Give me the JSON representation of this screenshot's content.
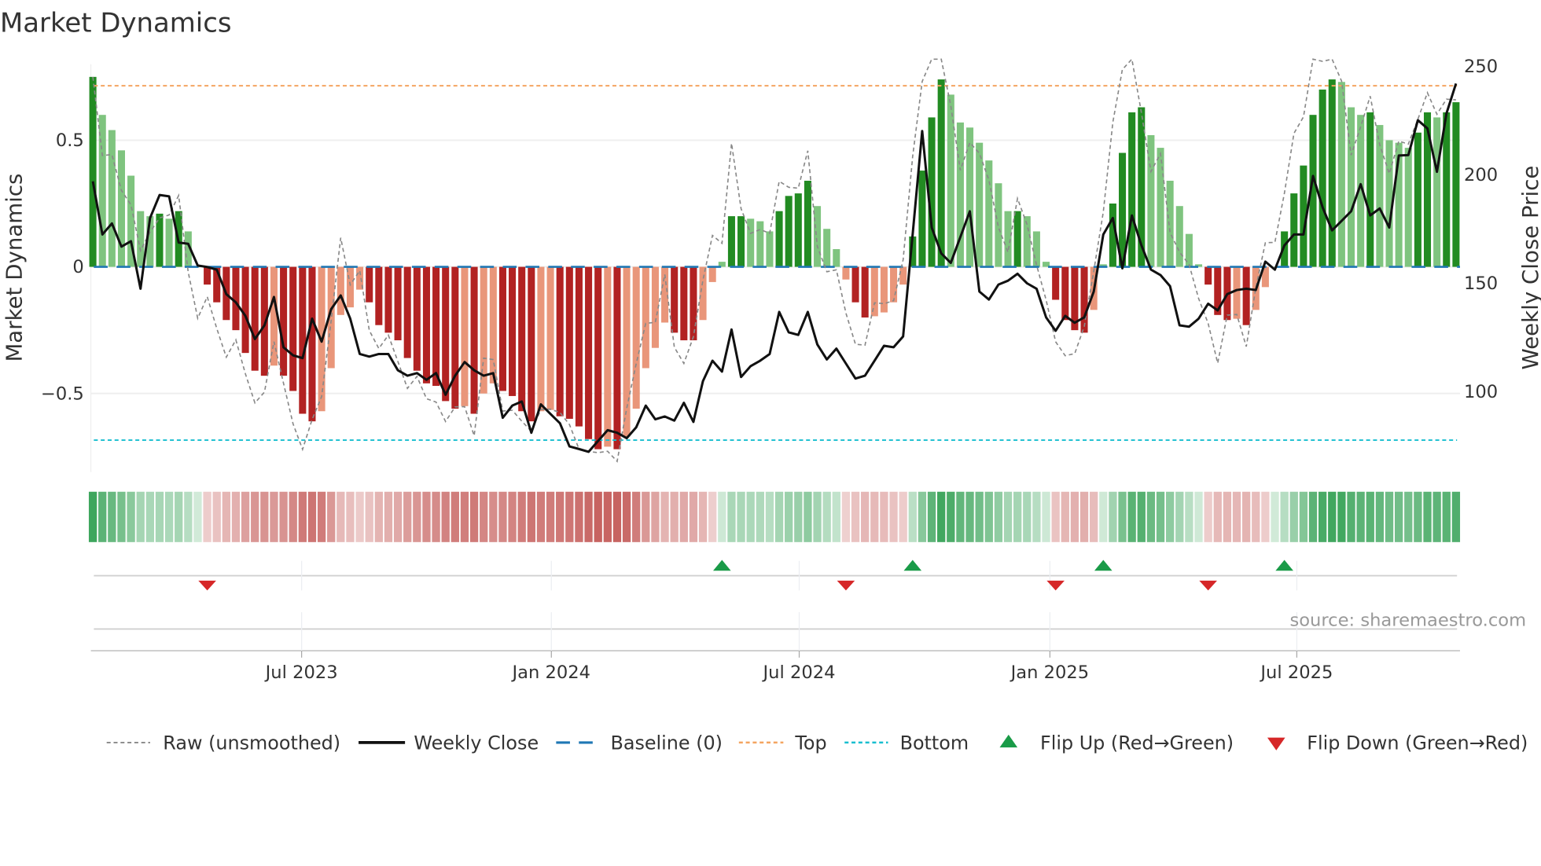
{
  "title": "Market Dynamics",
  "source": "source: sharemaestro.com",
  "colors": {
    "green_strong": "#228b22",
    "green_weak": "#7fc47f",
    "red_strong": "#b22222",
    "red_weak": "#e9967a",
    "heat_green": "#2e9e4f",
    "heat_red": "#c0504d",
    "raw": "#888888",
    "close": "#111111",
    "baseline": "#1f77b4",
    "top": "#f4a460",
    "bottom": "#17becf",
    "flip_up": "#1a9b48",
    "flip_down": "#d62728"
  },
  "chart_data": {
    "type": "bar",
    "title": "Market Dynamics",
    "ylabel": "Market Dynamics",
    "y2label": "Weekly Close Price",
    "xlabel": "",
    "ylim": [
      -0.81,
      0.8
    ],
    "y2lim": [
      63,
      251
    ],
    "yticks": [
      {
        "v": 0.5,
        "label": "0.5"
      },
      {
        "v": 0,
        "label": "0"
      },
      {
        "v": -0.5,
        "label": "−0.5"
      }
    ],
    "y2ticks": [
      {
        "v": 250,
        "label": "250"
      },
      {
        "v": 200,
        "label": "200"
      },
      {
        "v": 150,
        "label": "150"
      },
      {
        "v": 100,
        "label": "100"
      }
    ],
    "xticks": [
      {
        "week": 21.9,
        "label": "Jul 2023"
      },
      {
        "week": 48.1,
        "label": "Jan 2024"
      },
      {
        "week": 74.1,
        "label": "Jul 2024"
      },
      {
        "week": 100.4,
        "label": "Jan 2025"
      },
      {
        "week": 126.3,
        "label": "Jul 2025"
      }
    ],
    "top_level": 0.715,
    "bottom_level": -0.684,
    "baseline": 0,
    "grid": true,
    "legend_position": "bottom",
    "legend": [
      {
        "key": "raw",
        "label": "Raw (unsmoothed)"
      },
      {
        "key": "close",
        "label": "Weekly Close"
      },
      {
        "key": "baseline",
        "label": "Baseline (0)"
      },
      {
        "key": "top",
        "label": "Top"
      },
      {
        "key": "bottom",
        "label": "Bottom"
      },
      {
        "key": "flip_up",
        "label": "Flip Up (Red→Green)"
      },
      {
        "key": "flip_down",
        "label": "Flip Down (Green→Red)"
      }
    ],
    "dynamics": [
      0.75,
      0.6,
      0.54,
      0.46,
      0.36,
      0.22,
      0.2,
      0.21,
      0.19,
      0.22,
      0.14,
      0.0,
      -0.07,
      -0.14,
      -0.21,
      -0.25,
      -0.34,
      -0.41,
      -0.43,
      -0.39,
      -0.43,
      -0.49,
      -0.58,
      -0.61,
      -0.57,
      -0.4,
      -0.19,
      -0.16,
      -0.09,
      -0.14,
      -0.23,
      -0.26,
      -0.29,
      -0.36,
      -0.41,
      -0.46,
      -0.47,
      -0.53,
      -0.56,
      -0.55,
      -0.58,
      -0.5,
      -0.46,
      -0.49,
      -0.51,
      -0.57,
      -0.61,
      -0.57,
      -0.565,
      -0.59,
      -0.6,
      -0.63,
      -0.68,
      -0.72,
      -0.71,
      -0.72,
      -0.67,
      -0.56,
      -0.4,
      -0.32,
      -0.22,
      -0.26,
      -0.29,
      -0.29,
      -0.21,
      -0.06,
      0.02,
      0.2,
      0.2,
      0.19,
      0.18,
      0.14,
      0.22,
      0.28,
      0.29,
      0.34,
      0.24,
      0.15,
      0.07,
      -0.05,
      -0.14,
      -0.2,
      -0.195,
      -0.18,
      -0.14,
      -0.07,
      0.12,
      0.38,
      0.59,
      0.74,
      0.68,
      0.57,
      0.55,
      0.49,
      0.42,
      0.33,
      0.22,
      0.22,
      0.2,
      0.14,
      0.02,
      -0.13,
      -0.21,
      -0.25,
      -0.26,
      -0.17,
      0.01,
      0.25,
      0.45,
      0.61,
      0.63,
      0.52,
      0.47,
      0.34,
      0.24,
      0.13,
      0.01,
      -0.07,
      -0.19,
      -0.21,
      -0.205,
      -0.23,
      -0.17,
      -0.08,
      0.0,
      0.14,
      0.29,
      0.4,
      0.6,
      0.7,
      0.74,
      0.73,
      0.63,
      0.6,
      0.61,
      0.56,
      0.5,
      0.49,
      0.47,
      0.53,
      0.61,
      0.59,
      0.61,
      0.65
    ],
    "weekly_close": [
      197,
      172.5,
      177.6,
      166.9,
      169.4,
      147.5,
      180.1,
      190.7,
      190.1,
      168.8,
      168.2,
      158.2,
      157.5,
      156.3,
      145,
      141.2,
      135,
      124.3,
      130.6,
      143.7,
      120.5,
      116.8,
      115.5,
      133.7,
      123.1,
      138.1,
      144.4,
      133.7,
      117.4,
      116.2,
      117.4,
      117.4,
      109.9,
      107.4,
      108.6,
      105.5,
      108.6,
      98.6,
      107.4,
      113.7,
      109.9,
      107.4,
      108.6,
      88,
      93.6,
      95.5,
      81.1,
      94.2,
      89.8,
      85.5,
      74.8,
      73.6,
      72.3,
      77.3,
      82.3,
      81.1,
      78.6,
      83.6,
      93.6,
      87.3,
      88.6,
      86.7,
      94.9,
      86.1,
      104.9,
      114.3,
      109.3,
      128.7,
      106.8,
      111.8,
      114.3,
      117.4,
      136.8,
      127.4,
      126.2,
      136.8,
      121.8,
      114.9,
      119.9,
      113,
      106.1,
      107.4,
      114.3,
      121.2,
      120.5,
      125.5,
      172.5,
      220.2,
      175.7,
      163.8,
      159.4,
      171.3,
      183.2,
      146.2,
      142.5,
      149.4,
      151.2,
      154.4,
      150,
      147.5,
      134.3,
      128.1,
      135,
      131.8,
      134.3,
      146.2,
      172.5,
      180.1,
      156.9,
      181.3,
      167.5,
      156.3,
      153.8,
      148.7,
      130.6,
      130,
      133.7,
      140.6,
      137.5,
      145,
      146.9,
      147.5,
      146.9,
      160,
      156.3,
      167.5,
      172.5,
      172.5,
      199.5,
      185.1,
      174.4,
      178.8,
      183.2,
      195.7,
      181.3,
      184.5,
      175.7,
      208.9,
      209.1,
      225.2,
      221.4,
      201.4,
      228.3,
      242.1
    ]
  }
}
